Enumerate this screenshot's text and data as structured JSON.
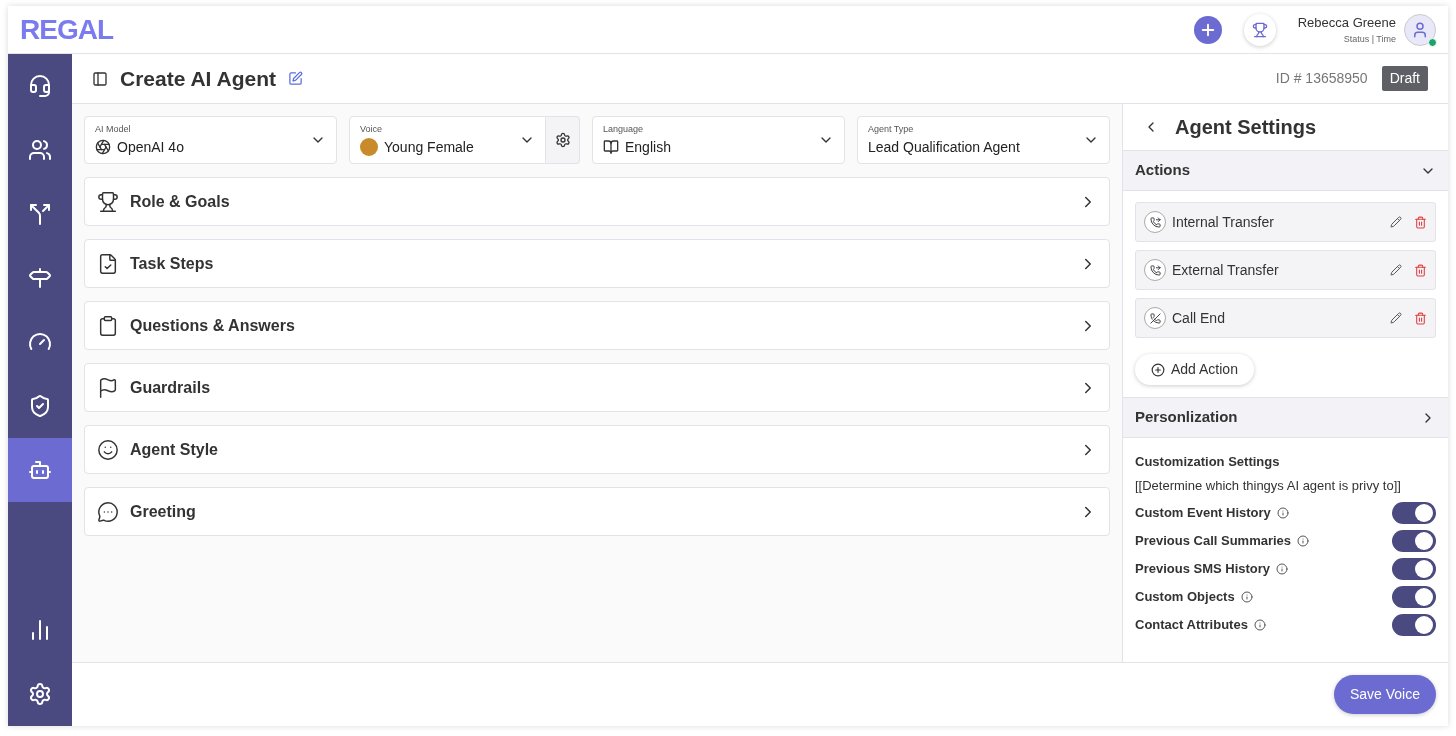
{
  "header": {
    "logo": "REGAL",
    "user": {
      "name": "Rebecca Greene",
      "status": "Status | Time",
      "online": true
    }
  },
  "nav": [
    {
      "kind": "headset",
      "selected": false
    },
    {
      "kind": "users",
      "selected": false
    },
    {
      "kind": "split",
      "selected": false
    },
    {
      "kind": "signpost",
      "selected": false
    },
    {
      "kind": "gauge",
      "selected": false
    },
    {
      "kind": "shield",
      "selected": false
    },
    {
      "kind": "bot",
      "selected": true
    }
  ],
  "nav_bottom": [
    {
      "kind": "chart",
      "selected": false
    },
    {
      "kind": "settings",
      "selected": false
    }
  ],
  "page": {
    "title": "Create AI Agent",
    "id": "ID # 13658950",
    "status": "Draft"
  },
  "selectors": [
    {
      "kind": "model",
      "label": "AI Model",
      "value": "OpenAI 4o"
    },
    {
      "kind": "voice",
      "label": "Voice",
      "value": "Young Female"
    },
    {
      "kind": "language",
      "label": "Language",
      "value": "English"
    },
    {
      "kind": "plain",
      "label": "Agent Type",
      "value": "Lead Qualification Agent"
    }
  ],
  "sections": [
    {
      "kind": "trophy",
      "title": "Role & Goals"
    },
    {
      "kind": "file",
      "title": "Task Steps"
    },
    {
      "kind": "clipboard",
      "title": "Questions & Answers"
    },
    {
      "kind": "flag",
      "title": "Guardrails"
    },
    {
      "kind": "smile",
      "title": "Agent Style"
    },
    {
      "kind": "chat",
      "title": "Greeting"
    }
  ],
  "settings": {
    "title": "Agent Settings",
    "actions": {
      "title": "Actions",
      "expanded": true,
      "items": [
        {
          "kind": "transfer",
          "label": "Internal Transfer"
        },
        {
          "kind": "transfer",
          "label": "External Transfer"
        },
        {
          "kind": "end",
          "label": "Call End"
        }
      ],
      "add_label": "Add Action"
    },
    "personalization": {
      "title": "Personlization",
      "expanded": false
    },
    "customization": {
      "title": "Customization Settings",
      "description": "[[Determine which thingys AI agent is privy to]]",
      "toggles": [
        {
          "label": "Custom Event History",
          "on": true
        },
        {
          "label": "Previous Call Summaries",
          "on": true
        },
        {
          "label": "Previous SMS History",
          "on": true
        },
        {
          "label": "Custom Objects",
          "on": true
        },
        {
          "label": "Contact Attributes",
          "on": true
        }
      ]
    }
  },
  "footer": {
    "button": "Save Voice"
  }
}
